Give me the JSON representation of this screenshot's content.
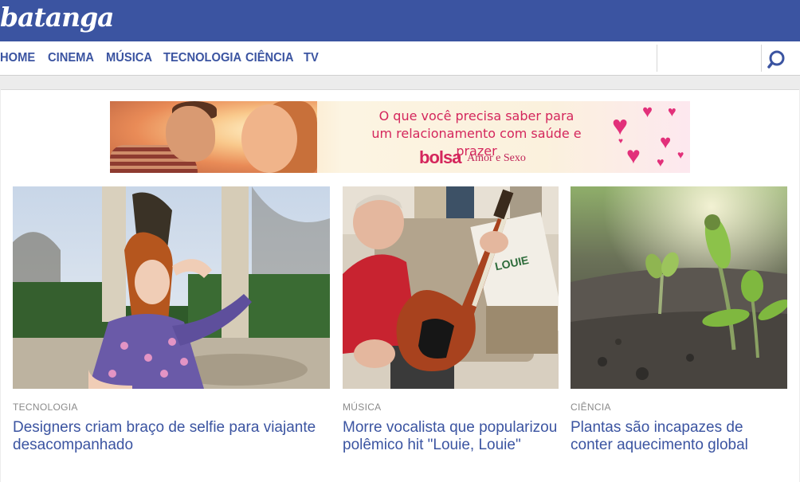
{
  "header": {
    "logo": "batanga",
    "brand_color": "#3b54a1"
  },
  "nav": {
    "items": [
      {
        "label": "HOME"
      },
      {
        "label": "CINEMA"
      },
      {
        "label": "MÚSICA"
      },
      {
        "label": "TECNOLOGIA"
      },
      {
        "label": "CIÊNCIA"
      },
      {
        "label": "TV"
      }
    ],
    "search_icon": "search-icon"
  },
  "ad": {
    "line1": "O que você precisa saber para",
    "line2": "um relacionamento com saúde e prazer",
    "brand": "bolsa",
    "brand_sub": "Amor e Sexo",
    "accent_color": "#d4265c"
  },
  "articles": [
    {
      "category": "TECNOLOGIA",
      "title_line1": "Designers criam braço de selfie para viajante",
      "title_line2": "desacompanhado"
    },
    {
      "category": "MÚSICA",
      "title_line1": "Morre vocalista que popularizou",
      "title_line2": "polêmico hit \"Louie, Louie\""
    },
    {
      "category": "CIÊNCIA",
      "title_line1": "Plantas são incapazes de",
      "title_line2": "conter aquecimento global"
    }
  ]
}
